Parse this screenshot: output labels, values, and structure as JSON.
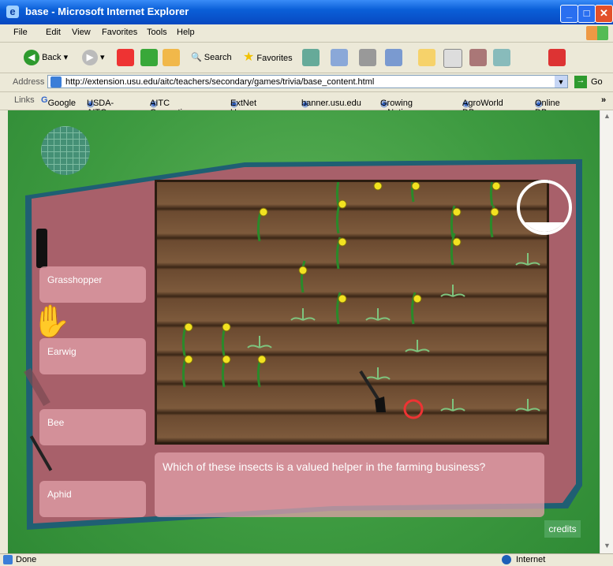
{
  "window": {
    "title": "base - Microsoft Internet Explorer"
  },
  "menu": [
    "File",
    "Edit",
    "View",
    "Favorites",
    "Tools",
    "Help"
  ],
  "toolbar": {
    "back": "Back",
    "search": "Search",
    "favorites": "Favorites"
  },
  "address": {
    "label": "Address",
    "url": "http://extension.usu.edu/aitc/teachers/secondary/games/trivia/base_content.html",
    "go": "Go"
  },
  "links": {
    "label": "Links",
    "items": [
      "Google",
      "USDA-AITC",
      "AITC Consortium",
      "ExtNet Home",
      "banner.usu.edu",
      "Growing a Nation",
      "AgroWorld DB",
      "Online DB"
    ]
  },
  "game": {
    "answers": [
      "Grasshopper",
      "Earwig",
      "Bee",
      "Aphid"
    ],
    "question": "Which of these insects is a valued helper in the farming business?",
    "credits": "credits",
    "tools": [
      "spray-bottle-icon",
      "glove-icon",
      "hoe-icon",
      "rake-icon"
    ]
  },
  "status": {
    "left": "Done",
    "zone": "Internet"
  }
}
